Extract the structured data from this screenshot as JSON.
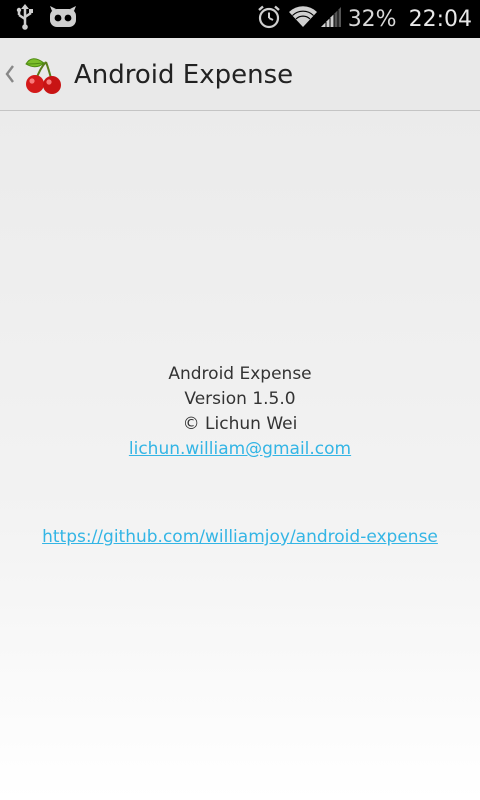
{
  "status_bar": {
    "battery": "32%",
    "time": "22:04",
    "icons": [
      "usb-icon",
      "cyanogenmod-icon",
      "alarm-icon",
      "wifi-icon",
      "signal-icon"
    ]
  },
  "action_bar": {
    "title": "Android Expense",
    "app_icon": "cherry-icon",
    "up_icon": "up-caret-icon"
  },
  "about": {
    "app_name": "Android Expense",
    "version": "Version 1.5.0",
    "copyright": "© Lichun Wei",
    "email": "lichun.william@gmail.com",
    "repo_url": "https://github.com/williamjoy/android-expense"
  },
  "colors": {
    "link": "#33b5e5",
    "action_bar_bg": "#e9e9e9",
    "status_bar_bg": "#000000"
  }
}
